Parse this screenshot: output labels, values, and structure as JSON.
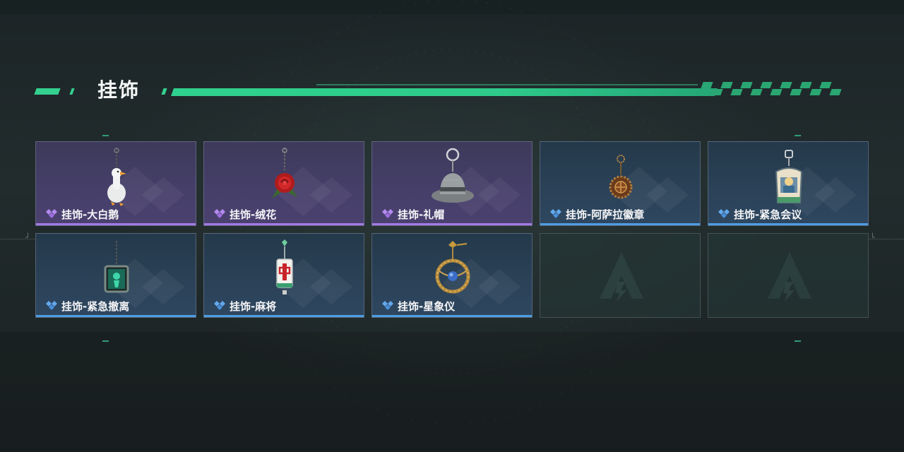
{
  "header": {
    "title": "挂饰"
  },
  "colors": {
    "accent": "#34d08f",
    "rare_purple": "#a27ae6",
    "rare_blue": "#4f9de3"
  },
  "items": [
    {
      "label": "挂饰-大白鹅",
      "rarity": "purple",
      "icon": "goose-charm-icon"
    },
    {
      "label": "挂饰-绒花",
      "rarity": "purple",
      "icon": "rose-charm-icon"
    },
    {
      "label": "挂饰-礼帽",
      "rarity": "purple",
      "icon": "hat-charm-icon"
    },
    {
      "label": "挂饰-阿萨拉徽章",
      "rarity": "blue",
      "icon": "badge-charm-icon"
    },
    {
      "label": "挂饰-紧急会议",
      "rarity": "blue",
      "icon": "meeting-charm-icon"
    },
    {
      "label": "挂饰-紧急撤离",
      "rarity": "blue",
      "icon": "evac-charm-icon"
    },
    {
      "label": "挂饰-麻将",
      "rarity": "blue",
      "icon": "mahjong-charm-icon"
    },
    {
      "label": "挂饰-星象仪",
      "rarity": "blue",
      "icon": "astrolabe-charm-icon"
    },
    {
      "label": "",
      "rarity": "empty",
      "icon": "empty-slot-logo-icon"
    },
    {
      "label": "",
      "rarity": "empty",
      "icon": "empty-slot-logo-icon"
    }
  ]
}
